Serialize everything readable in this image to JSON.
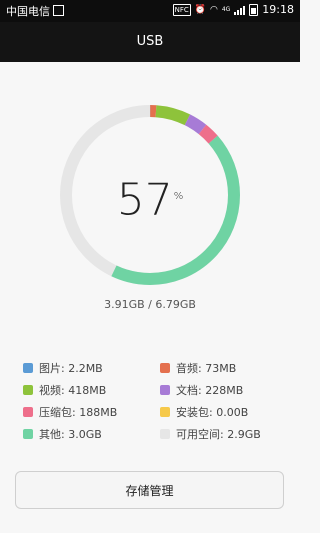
{
  "status_bar": {
    "carrier": "中国电信",
    "carrier_icon": "sim-card-icon",
    "nfc_label": "NFC",
    "network_label": "4G",
    "time": "19:18"
  },
  "app_bar": {
    "title": "USB"
  },
  "storage": {
    "percent": "57",
    "percent_sign": "%",
    "usage_text": "3.91GB / 6.79GB",
    "used_fraction": 0.57,
    "ring_track_color": "#e6e6e6"
  },
  "legend": [
    {
      "label": "图片: 2.2MB",
      "color": "#5b9bd5",
      "share": 0.0004
    },
    {
      "label": "音频: 73MB",
      "color": "#e4704e",
      "share": 0.011
    },
    {
      "label": "视频: 418MB",
      "color": "#8ec33b",
      "share": 0.062
    },
    {
      "label": "文档: 228MB",
      "color": "#a77bd6",
      "share": 0.034
    },
    {
      "label": "压缩包: 188MB",
      "color": "#ee6f8b",
      "share": 0.028
    },
    {
      "label": "安装包: 0.00B",
      "color": "#f6c94a",
      "share": 0
    },
    {
      "label": "其他: 3.0GB",
      "color": "#6fd3a3",
      "share": 0.435
    },
    {
      "label": "可用空间: 2.9GB",
      "color": "#e6e6e6",
      "share": 0.43
    }
  ],
  "actions": {
    "manage_label": "存储管理"
  }
}
